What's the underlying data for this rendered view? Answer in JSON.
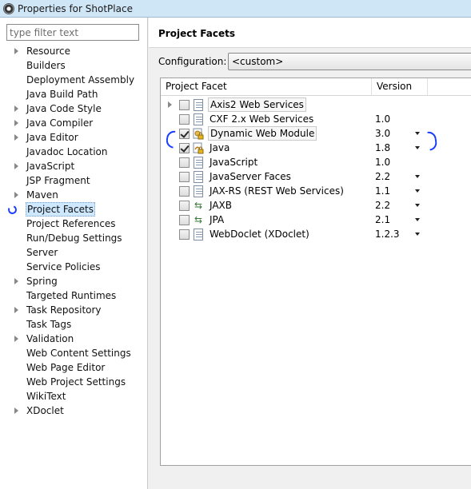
{
  "window": {
    "title": "Properties for ShotPlace"
  },
  "filter": {
    "placeholder": "type filter text"
  },
  "sidebar": {
    "items": [
      {
        "label": "Resource",
        "expandable": true
      },
      {
        "label": "Builders",
        "expandable": false
      },
      {
        "label": "Deployment Assembly",
        "expandable": false
      },
      {
        "label": "Java Build Path",
        "expandable": false
      },
      {
        "label": "Java Code Style",
        "expandable": true
      },
      {
        "label": "Java Compiler",
        "expandable": true
      },
      {
        "label": "Java Editor",
        "expandable": true
      },
      {
        "label": "Javadoc Location",
        "expandable": false
      },
      {
        "label": "JavaScript",
        "expandable": true
      },
      {
        "label": "JSP Fragment",
        "expandable": false
      },
      {
        "label": "Maven",
        "expandable": true
      },
      {
        "label": "Project Facets",
        "expandable": false,
        "selected": true
      },
      {
        "label": "Project References",
        "expandable": false
      },
      {
        "label": "Run/Debug Settings",
        "expandable": false
      },
      {
        "label": "Server",
        "expandable": false
      },
      {
        "label": "Service Policies",
        "expandable": false
      },
      {
        "label": "Spring",
        "expandable": true
      },
      {
        "label": "Targeted Runtimes",
        "expandable": false
      },
      {
        "label": "Task Repository",
        "expandable": true
      },
      {
        "label": "Task Tags",
        "expandable": false
      },
      {
        "label": "Validation",
        "expandable": true
      },
      {
        "label": "Web Content Settings",
        "expandable": false
      },
      {
        "label": "Web Page Editor",
        "expandable": false
      },
      {
        "label": "Web Project Settings",
        "expandable": false
      },
      {
        "label": "WikiText",
        "expandable": false
      },
      {
        "label": "XDoclet",
        "expandable": true
      }
    ]
  },
  "main": {
    "title": "Project Facets",
    "configuration_label": "Configuration:",
    "configuration_value": "<custom>",
    "table": {
      "headers": {
        "facet": "Project Facet",
        "version": "Version"
      },
      "rows": [
        {
          "name": "Axis2 Web Services",
          "version": "",
          "checked": false,
          "expandable": true,
          "icon": "document-icon",
          "has_dropdown": false
        },
        {
          "name": "CXF 2.x Web Services",
          "version": "1.0",
          "checked": false,
          "expandable": false,
          "icon": "document-icon",
          "has_dropdown": false
        },
        {
          "name": "Dynamic Web Module",
          "version": "3.0",
          "checked": true,
          "expandable": false,
          "icon": "web-module-lock-icon",
          "has_dropdown": true
        },
        {
          "name": "Java",
          "version": "1.8",
          "checked": true,
          "expandable": false,
          "icon": "java-lock-icon",
          "has_dropdown": true
        },
        {
          "name": "JavaScript",
          "version": "1.0",
          "checked": false,
          "expandable": false,
          "icon": "document-icon",
          "has_dropdown": false
        },
        {
          "name": "JavaServer Faces",
          "version": "2.2",
          "checked": false,
          "expandable": false,
          "icon": "document-icon",
          "has_dropdown": true
        },
        {
          "name": "JAX-RS (REST Web Services)",
          "version": "1.1",
          "checked": false,
          "expandable": false,
          "icon": "document-icon",
          "has_dropdown": true
        },
        {
          "name": "JAXB",
          "version": "2.2",
          "checked": false,
          "expandable": false,
          "icon": "bidirectional-arrows-icon",
          "has_dropdown": true
        },
        {
          "name": "JPA",
          "version": "2.1",
          "checked": false,
          "expandable": false,
          "icon": "bidirectional-arrows-icon",
          "has_dropdown": true
        },
        {
          "name": "WebDoclet (XDoclet)",
          "version": "1.2.3",
          "checked": false,
          "expandable": false,
          "icon": "document-icon",
          "has_dropdown": true
        }
      ]
    }
  },
  "colors": {
    "titlebar": "#cfe6f7",
    "selection": "#cde8ff",
    "annotation_pen": "#1a3cff"
  }
}
